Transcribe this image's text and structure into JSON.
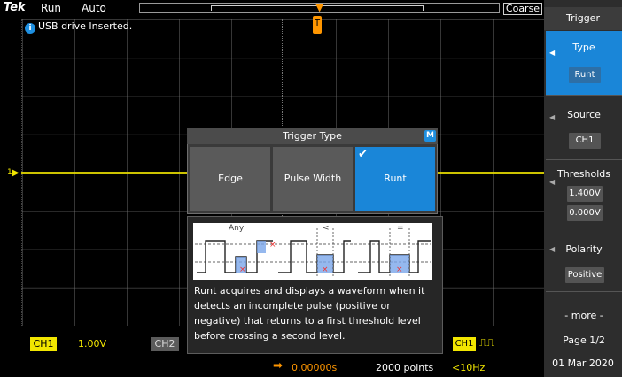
{
  "top_bar": {
    "brand": "Tek",
    "run_state": "Run",
    "trigger_mode": "Auto",
    "coarse_label": "Coarse"
  },
  "notification": {
    "icon": "info-icon",
    "text": "USB drive Inserted."
  },
  "channel_marker": "1",
  "side_menu": {
    "title": "Trigger",
    "type": {
      "label": "Type",
      "value": "Runt"
    },
    "source": {
      "label": "Source",
      "value": "CH1"
    },
    "thresholds": {
      "label": "Thresholds",
      "upper": "1.400V",
      "lower": "0.000V"
    },
    "polarity": {
      "label": "Polarity",
      "value": "Positive"
    },
    "more": "- more -",
    "page": "Page 1/2",
    "date": "01 Mar 2020"
  },
  "bottom_bar": {
    "ch1_label": "CH1",
    "ch1_scale": "1.00V",
    "ch2_label": "CH2",
    "trigger_source": "CH1",
    "horizontal_delay": "0.00000s",
    "record_length": "2000 points",
    "frequency": "<10Hz"
  },
  "dialog": {
    "title": "Trigger Type",
    "badge": "M",
    "options": [
      "Edge",
      "Pulse Width",
      "Runt"
    ],
    "selected": "Runt"
  },
  "help": {
    "diagram_labels": {
      "any": "Any",
      "less": "<",
      "equal": "="
    },
    "description": "Runt acquires and displays a waveform when it detects an incomplete pulse (positive or negative) that returns to a first threshold level before crossing a second level."
  },
  "colors": {
    "ch1": "#f2e600",
    "accent": "#1a86d8",
    "trigger": "#ff9600",
    "background": "#000000",
    "menu_bg": "#2d2d2d"
  }
}
